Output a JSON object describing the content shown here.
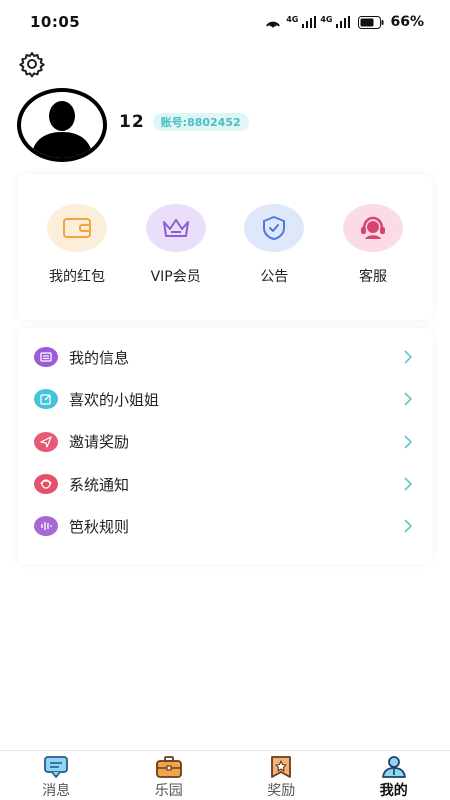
{
  "status_bar": {
    "time": "10:05",
    "signal_1": "4G",
    "signal_2": "4G",
    "battery": "66%"
  },
  "profile": {
    "name": "12",
    "account": "账号:8802452"
  },
  "quick_actions": [
    {
      "label": "我的红包",
      "icon": "wallet-icon",
      "bg": "#fdeed9",
      "color": "#f0a53f"
    },
    {
      "label": "VIP会员",
      "icon": "crown-icon",
      "bg": "#e9dff9",
      "color": "#8c5cd9"
    },
    {
      "label": "公告",
      "icon": "shield-icon",
      "bg": "#dfe8fb",
      "color": "#4e79e0"
    },
    {
      "label": "客服",
      "icon": "headset-icon",
      "bg": "#fbdce6",
      "color": "#d8466f"
    }
  ],
  "menu": [
    {
      "label": "我的信息",
      "icon": "info-card-icon",
      "color": "#9a5ad9"
    },
    {
      "label": "喜欢的小姐姐",
      "icon": "edit-icon",
      "color": "#45c4d8"
    },
    {
      "label": "邀请奖励",
      "icon": "send-icon",
      "color": "#e45b76"
    },
    {
      "label": "系统通知",
      "icon": "notify-icon",
      "color": "#e4516c"
    },
    {
      "label": "笆秋规则",
      "icon": "rules-icon",
      "color": "#a868d4"
    }
  ],
  "tabs": [
    {
      "label": "消息",
      "icon": "message-icon"
    },
    {
      "label": "乐园",
      "icon": "briefcase-icon"
    },
    {
      "label": "奖励",
      "icon": "reward-icon"
    },
    {
      "label": "我的",
      "icon": "user-icon",
      "active": true
    }
  ],
  "colors": {
    "chevron": "#5ec9c4",
    "badge_bg": "#dff6f6",
    "badge_text": "#4bbec3"
  }
}
